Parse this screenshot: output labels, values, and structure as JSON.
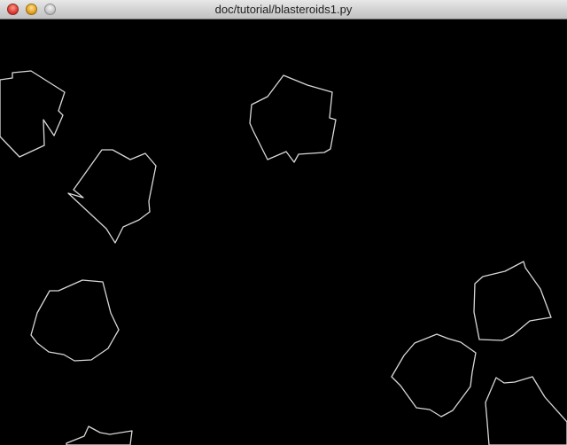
{
  "window": {
    "title": "doc/tutorial/blasteroids1.py"
  },
  "titlebar_buttons": {
    "close": "close-button",
    "minimize": "minimize-button",
    "zoom": "zoom-button"
  },
  "game": {
    "background_color": "#000000",
    "stroke_color": "#d8d8d8",
    "asteroid_count": 8
  }
}
